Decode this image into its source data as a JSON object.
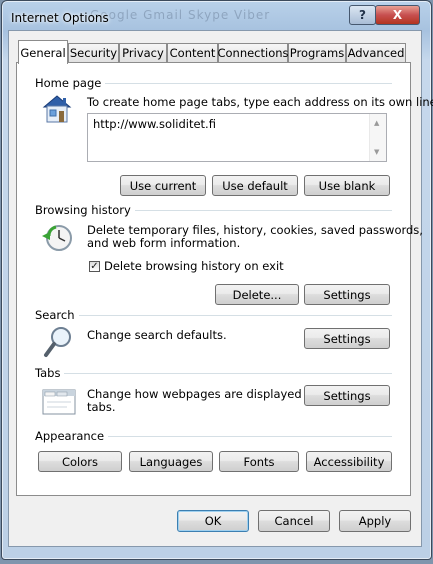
{
  "window": {
    "title": "Internet Options",
    "background_text": "Google   Gmail   Skype   Viber",
    "help_label": "?",
    "close_label": "X"
  },
  "tabs": [
    "General",
    "Security",
    "Privacy",
    "Content",
    "Connections",
    "Programs",
    "Advanced"
  ],
  "active_tab": "General",
  "home_page": {
    "label": "Home page",
    "description": "To create home page tabs, type each address on its own line.",
    "url": "http://www.soliditet.fi",
    "buttons": {
      "use_current": "Use current",
      "use_default": "Use default",
      "use_blank": "Use blank"
    }
  },
  "browsing_history": {
    "label": "Browsing history",
    "description_line1": "Delete temporary files, history, cookies, saved passwords,",
    "description_line2": "and web form information.",
    "checkbox_label": "Delete browsing history on exit",
    "checkbox_checked": true,
    "buttons": {
      "delete": "Delete...",
      "settings": "Settings"
    }
  },
  "search": {
    "label": "Search",
    "description": "Change search defaults.",
    "settings": "Settings"
  },
  "tabs_section": {
    "label": "Tabs",
    "description_line1": "Change how webpages are displayed in",
    "description_line2": "tabs.",
    "settings": "Settings"
  },
  "appearance": {
    "label": "Appearance",
    "buttons": {
      "colors": "Colors",
      "languages": "Languages",
      "fonts": "Fonts",
      "accessibility": "Accessibility"
    }
  },
  "dialog_buttons": {
    "ok": "OK",
    "cancel": "Cancel",
    "apply": "Apply"
  },
  "colors": {
    "accent": "#3c7fb1",
    "frame": "#b9d1ea",
    "close": "#c75050"
  },
  "icons": [
    "house-icon",
    "history-clock-icon",
    "magnifier-icon",
    "tabs-window-icon"
  ]
}
